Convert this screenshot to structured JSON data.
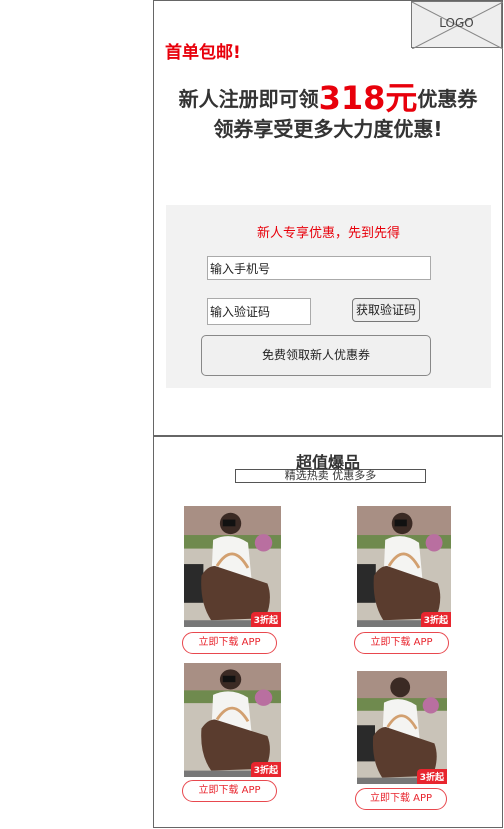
{
  "colors": {
    "accent_red": "#e8000b",
    "panel_bg": "#f2f2f2"
  },
  "logo": {
    "text": "LOGO"
  },
  "promo": {
    "free_shipping": "首单包邮!",
    "headline_before": "新人注册即可领",
    "headline_amount": "318元",
    "headline_after": "优惠券",
    "subline": "领券享受更多大力度优惠!"
  },
  "form": {
    "title": "新人专享优惠，先到先得",
    "phone_value": "输入手机号",
    "code_value": "输入验证码",
    "sms_button": "获取验证码",
    "claim_button": "免费领取新人优惠券"
  },
  "products_section": {
    "title": "超值爆品",
    "subtitle": "精选热卖  优惠多多",
    "items": [
      {
        "discount": "3折起",
        "button": "立即下载 APP",
        "image_icon": "handbag-photo"
      },
      {
        "discount": "3折起",
        "button": "立即下载 APP",
        "image_icon": "handbag-photo"
      },
      {
        "discount": "3折起",
        "button": "立即下载 APP",
        "image_icon": "handbag-photo"
      },
      {
        "discount": "3折起",
        "button": "立即下载 APP",
        "image_icon": "handbag-photo"
      }
    ]
  }
}
